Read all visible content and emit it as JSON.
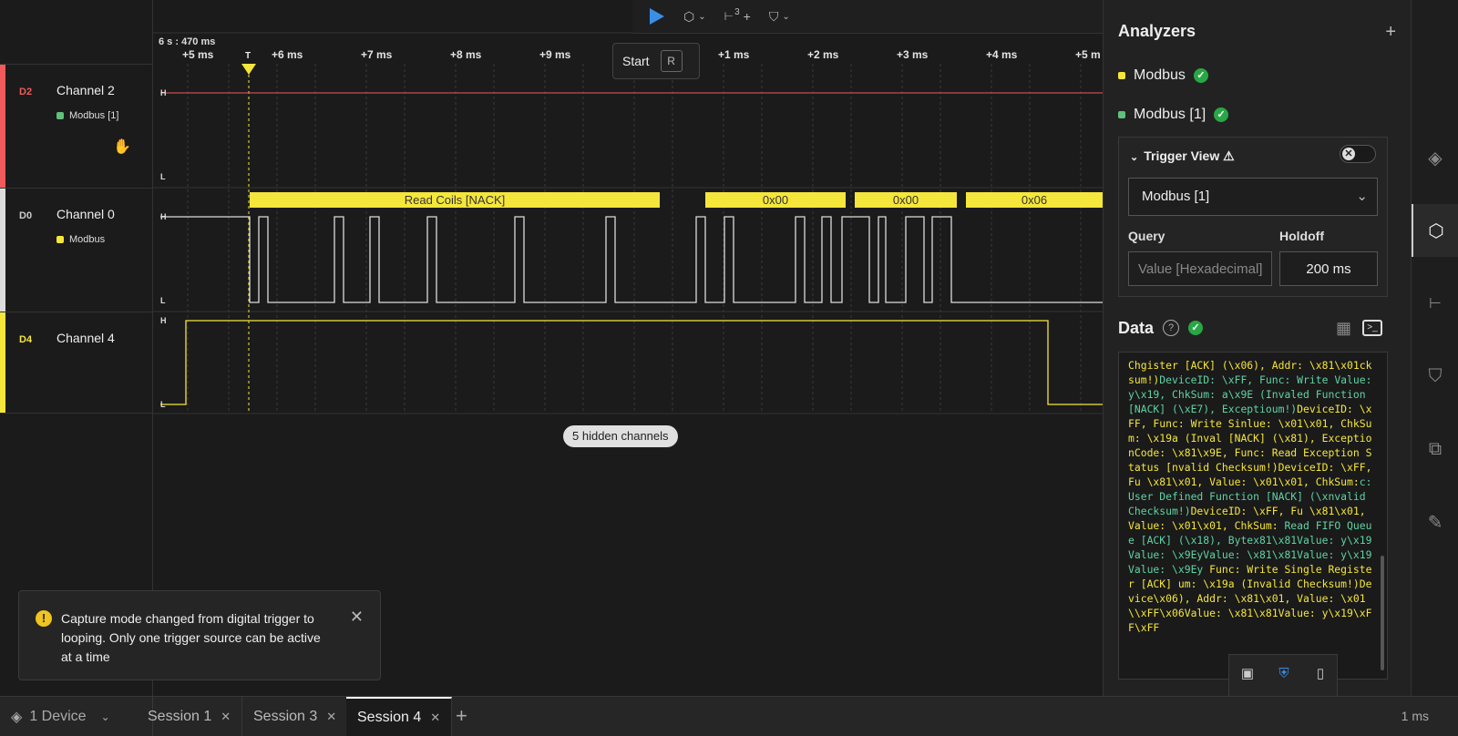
{
  "toolbar": {
    "start_tooltip": "Start",
    "start_key": "R",
    "measure_badge": "3",
    "measure_plus": "+"
  },
  "timeline": {
    "offset_label": "6 s : 470 ms",
    "ticks": [
      "+5 ms",
      "+6 ms",
      "+7 ms",
      "+8 ms",
      "+9 ms",
      "+1 ms",
      "+2 ms",
      "+3 ms",
      "+4 ms",
      "+5 m"
    ],
    "trigger_marker": "T",
    "high": "H",
    "low": "L"
  },
  "channels": [
    {
      "tag": "D2",
      "name": "Channel 2",
      "analyzer": "Modbus [1]",
      "color": "#f05a5a",
      "analyzer_color": "#5fc17a"
    },
    {
      "tag": "D0",
      "name": "Channel 0",
      "analyzer": "Modbus",
      "color": "#dddddd",
      "analyzer_color": "#f5e63c"
    },
    {
      "tag": "D4",
      "name": "Channel 4",
      "analyzer": "",
      "color": "#f5e63c",
      "analyzer_color": ""
    }
  ],
  "protocol_frames": [
    "Read Coils [NACK]",
    "0x00",
    "0x00",
    "0x06"
  ],
  "hidden_channels": "5 hidden channels",
  "toast": {
    "message": "Capture mode changed from digital trigger to looping. Only one trigger source can be active at a time",
    "icon": "!"
  },
  "analyzers_panel": {
    "title": "Analyzers",
    "add": "+",
    "items": [
      {
        "name": "Modbus",
        "color": "#f5e63c"
      },
      {
        "name": "Modbus [1]",
        "color": "#5fc17a"
      }
    ],
    "trigger_view": {
      "title": "Trigger View ⚠",
      "toggle_glyph": "✕",
      "selected_analyzer": "Modbus [1]",
      "query_label": "Query",
      "query_placeholder": "Value [Hexadecimal]",
      "holdoff_label": "Holdoff",
      "holdoff_value": "200 ms"
    },
    "data": {
      "title": "Data",
      "help": "?",
      "console_segments": [
        {
          "c": "y",
          "t": "Chgister [ACK] (\\x06), Addr: \\x81\\x01cksum!)"
        },
        {
          "c": "g",
          "t": "DeviceID: \\xFF, Func: Write  Value: y\\x19, ChkSum: a\\x9E (Invaled Function [NACK] (\\xE7), Exceptioum!)"
        },
        {
          "c": "y",
          "t": "DeviceID: \\xFF, Func: Write Sinlue: \\x01\\x01, ChkSum: \\x19a (Inval [NACK] (\\x81), ExceptionCode: \\x81\\x9E, Func: Read Exception Status [nvalid Checksum!)"
        },
        {
          "c": "y",
          "t": "DeviceID: \\xFF, Fu \\x81\\x01, Value: \\x01\\x01, ChkSum:"
        },
        {
          "c": "g",
          "t": "c: User Defined Function [NACK] (\\xnvalid Checksum!)"
        },
        {
          "c": "y",
          "t": "DeviceID: \\xFF, Fu \\x81\\x01, Value: \\x01\\x01, ChkSum:"
        },
        {
          "c": "g",
          "t": " Read FIFO Queue [ACK] (\\x18), Bytex81\\x81Value: y\\x19Value: \\x9EyValue: \\x81\\x81Value: y\\x19Value: \\x9Ey"
        },
        {
          "c": "y",
          "t": " Func: Write Single Register [ACK] um: \\x19a (Invalid Checksum!)Device\\x06), Addr: \\x81\\x01, Value: \\x01\\\\xFF\\x06Value: \\x81\\x81Value: y\\x19\\xFF\\xFF"
        }
      ]
    }
  },
  "bottom": {
    "device": "1 Device",
    "sessions": [
      {
        "label": "Session 1",
        "active": false
      },
      {
        "label": "Session 3",
        "active": false
      },
      {
        "label": "Session 4",
        "active": true
      }
    ],
    "add_tab": "+",
    "zoom": "1 ms"
  }
}
